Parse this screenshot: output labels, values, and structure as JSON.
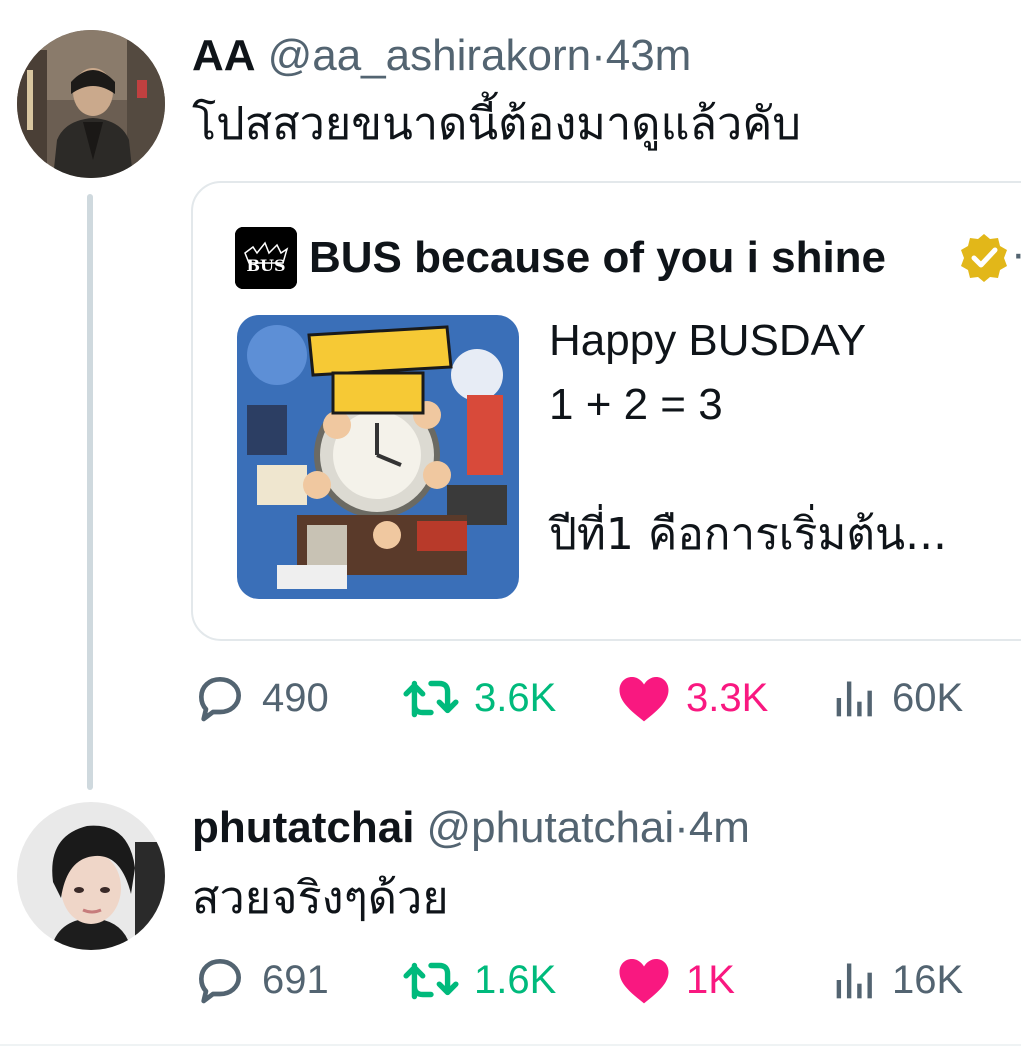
{
  "tweet1": {
    "name": "AA",
    "handle": "@aa_ashirakorn",
    "separator": "·",
    "time": "43m",
    "text": "โปสสวยขนาดนี้ต้องมาดูแล้วคับ",
    "quote": {
      "name": "BUS because of you i shine",
      "more": "·",
      "logo_text": "BUS",
      "line1": "Happy BUSDAY",
      "line2": "1 + 2 = 3",
      "line3": "ปีที่1 คือการเริ่มต้น..."
    },
    "stats": {
      "replies": "490",
      "retweets": "3.6K",
      "likes": "3.3K",
      "views": "60K"
    }
  },
  "tweet2": {
    "name": "phutatchai",
    "handle": "@phutatchai",
    "separator": "·",
    "time": "4m",
    "text": "สวยจริงๆด้วย",
    "stats": {
      "replies": "691",
      "retweets": "1.6K",
      "likes": "1K",
      "views": "16K"
    }
  },
  "icons": {
    "reply": "reply-icon",
    "retweet": "retweet-icon",
    "like": "heart-filled-icon",
    "views": "views-icon",
    "verified": "verified-badge-icon"
  },
  "colors": {
    "secondary_text": "#536471",
    "retweet": "#00ba7c",
    "like": "#f91880",
    "verified_gold": "#e2b719",
    "border": "#e3e8eb"
  }
}
